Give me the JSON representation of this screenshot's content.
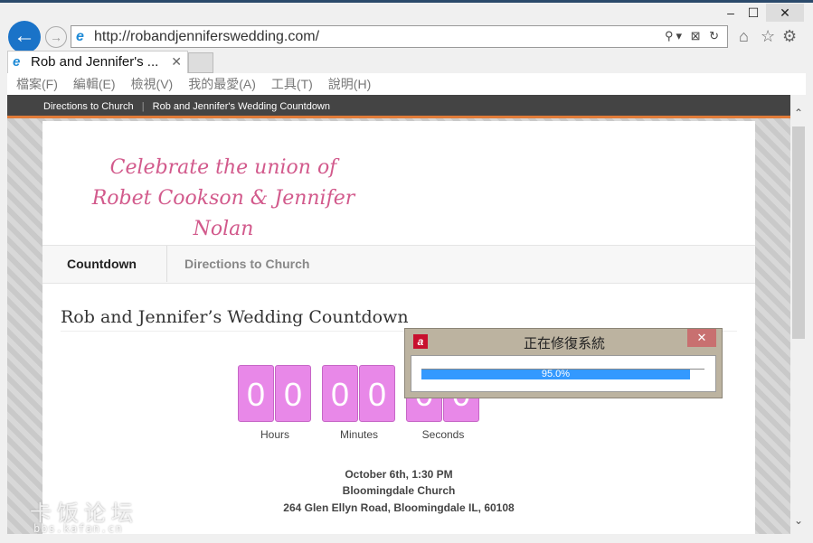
{
  "browser": {
    "url": "http://robandjenniferswedding.com/",
    "tab_title": "Rob and Jennifer's ...",
    "menu": [
      "檔案(F)",
      "編輯(E)",
      "檢視(V)",
      "我的最愛(A)",
      "工具(T)",
      "說明(H)"
    ]
  },
  "site": {
    "top_nav": [
      "Directions to Church",
      "Rob and Jennifer's Wedding Countdown"
    ],
    "logo_lines": [
      "Celebrate the union of",
      "Robet Cookson & Jennifer Nolan"
    ],
    "nav": [
      "Countdown",
      "Directions to Church"
    ],
    "title": "Rob and Jennifer’s Wedding Countdown",
    "countdown": {
      "hours": [
        "0",
        "0"
      ],
      "minutes": [
        "0",
        "0"
      ],
      "seconds": [
        "0",
        "0"
      ],
      "labels": [
        "Hours",
        "Minutes",
        "Seconds"
      ]
    },
    "info": [
      "October 6th, 1:30 PM",
      "Bloomingdale Church",
      "264 Glen Ellyn Road, Bloomingdale IL, 60108"
    ]
  },
  "dialog": {
    "title": "正在修復系統",
    "progress_percent": 95.0,
    "progress_label": "95.0%",
    "accent": "#3399ff"
  },
  "watermark": {
    "text": "卡饭论坛",
    "sub": "bbs.kafan.cn"
  }
}
